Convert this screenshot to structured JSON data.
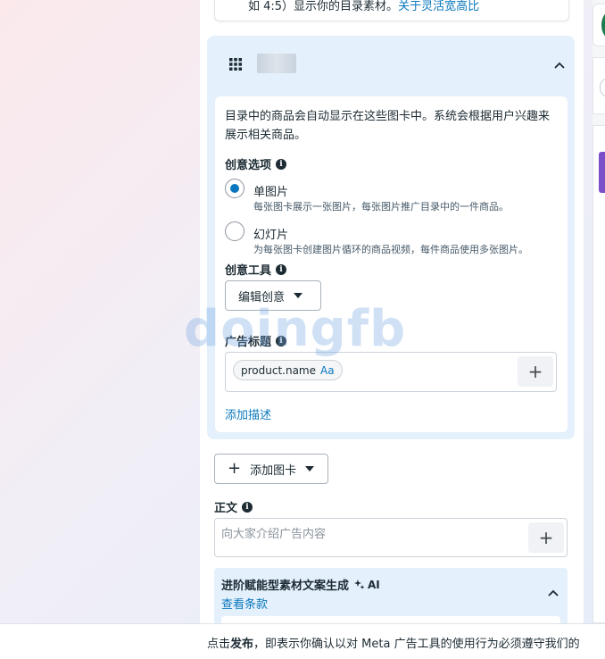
{
  "previous_card": {
    "text": "如 4:5）显示你的目录素材。",
    "link": "关于灵活宽高比"
  },
  "catalog_section": {
    "description": "目录中的商品会自动显示在这些图卡中。系统会根据用户兴趣来展示相关商品。",
    "creative_options_label": "创意选项",
    "options": [
      {
        "title": "单图片",
        "subtitle": "每张图卡展示一张图片，每张图片推广目录中的一件商品。",
        "selected": true
      },
      {
        "title": "幻灯片",
        "subtitle": "为每张图卡创建图片循环的商品视频，每件商品使用多张图片。",
        "selected": false
      }
    ],
    "creative_tools_label": "创意工具",
    "edit_creative_button": "编辑创意",
    "headline_label": "广告标题",
    "headline_token": "product.name",
    "headline_token_suffix": "Aa",
    "add_description_link": "添加描述"
  },
  "add_card_button": "添加图卡",
  "primary_text": {
    "label": "正文",
    "placeholder": "向大家介绍广告内容"
  },
  "ai_section": {
    "title": "进阶赋能型素材文案生成",
    "ai_badge": "AI",
    "terms_link": "查看条款"
  },
  "footer": {
    "prefix": "点击",
    "bold": "发布",
    "suffix": "，即表示你确认以对 Meta 广告工具的使用行为必须遵守我们的"
  },
  "watermark": "doingfb",
  "icons": {
    "section": "grid-icon",
    "collapse": "chevron-up-icon",
    "info": "info-icon",
    "dropdown": "caret-down-icon",
    "add": "plus-icon",
    "ai": "sparkle-icon"
  },
  "colors": {
    "accent": "#0a78be",
    "section_bg": "#e4f0fb",
    "text": "#1c2b33"
  }
}
